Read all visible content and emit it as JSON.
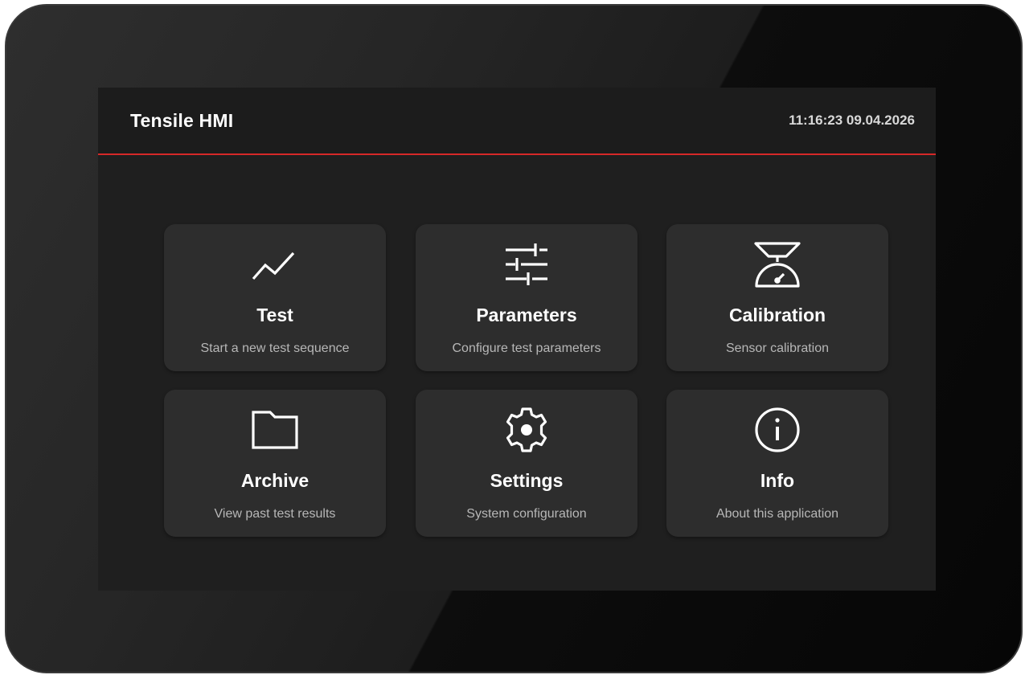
{
  "header": {
    "title": "Tensile HMI",
    "datetime": "11:16:23 09.04.2026"
  },
  "accent_color": "#d62828",
  "tiles": [
    {
      "title": "Test",
      "subtitle": "Start a new test sequence",
      "icon": "line-chart-icon"
    },
    {
      "title": "Parameters",
      "subtitle": "Configure test parameters",
      "icon": "sliders-icon"
    },
    {
      "title": "Calibration",
      "subtitle": "Sensor calibration",
      "icon": "scale-icon"
    },
    {
      "title": "Archive",
      "subtitle": "View past test results",
      "icon": "folder-icon"
    },
    {
      "title": "Settings",
      "subtitle": "System configuration",
      "icon": "gear-icon"
    },
    {
      "title": "Info",
      "subtitle": "About this application",
      "icon": "info-icon"
    }
  ]
}
